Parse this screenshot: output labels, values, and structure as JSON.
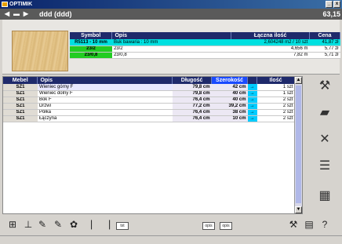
{
  "window": {
    "app_title": "OPTIMIK"
  },
  "header": {
    "title": "ddd (ddd)",
    "price": "63,15"
  },
  "price_table": {
    "columns": [
      "Symbol",
      "Opis",
      "Łączna ilość",
      "Cena"
    ],
    "rows": [
      {
        "symbol": "R5113 - 10 mm",
        "opis": "Buk bawaria : 10 mm",
        "ilosc": "2,604248 m2 / 10 szt",
        "cena": "41,87 zł"
      },
      {
        "symbol": "23/2",
        "opis": "23/2",
        "ilosc": "4,656 m",
        "cena": "5,77 zł"
      },
      {
        "symbol": "23/0,8",
        "opis": "23/0,8",
        "ilosc": "7,82 m",
        "cena": "5,71 zł"
      }
    ]
  },
  "elements_table": {
    "columns": [
      "Mebel",
      "Opis",
      "Długość",
      "Szerokość",
      "",
      "Ilość"
    ],
    "rows": [
      {
        "mebel": "SZ1",
        "opis": "Wieniec górny F",
        "dlugosc": "79,8 cm",
        "szerokosc": "42 cm",
        "arrow": "→",
        "ilosc": "1 szt"
      },
      {
        "mebel": "SZ1",
        "opis": "Wieniec dolny F",
        "dlugosc": "79,8 cm",
        "szerokosc": "40 cm",
        "arrow": "→",
        "ilosc": "1 szt"
      },
      {
        "mebel": "SZ1",
        "opis": "Bok F",
        "dlugosc": "76,4 cm",
        "szerokosc": "40 cm",
        "arrow": "→",
        "ilosc": "2 szt"
      },
      {
        "mebel": "SZ1",
        "opis": "Drzwi",
        "dlugosc": "77,2 cm",
        "szerokosc": "39,2 cm",
        "arrow": "→",
        "ilosc": "2 szt"
      },
      {
        "mebel": "SZ1",
        "opis": "Półka",
        "dlugosc": "76,4 cm",
        "szerokosc": "38 cm",
        "arrow": "→",
        "ilosc": "2 szt"
      },
      {
        "mebel": "SZ1",
        "opis": "Łączyna",
        "dlugosc": "76,4 cm",
        "szerokosc": "10 cm",
        "arrow": "→",
        "ilosc": "2 szt"
      }
    ]
  },
  "toolbar": {
    "txt_label": "txt",
    "opis_label": "opis"
  },
  "colors": {
    "title_bar": "#0a246a",
    "header_bg": "#5a5a5a",
    "table_header": "#1f2a6b",
    "highlight_cyan": "#00e0e0",
    "highlight_green": "#22cc22",
    "szerokosc_arrow": "#00ccff"
  },
  "icons": {
    "side": [
      "saw-icon",
      "panels-icon",
      "cross-icon",
      "layers-icon",
      "cabinet-icon"
    ],
    "bottom": [
      "add-element-icon",
      "drill-icon",
      "edge-band-icon",
      "edge-band-alt-icon",
      "tools-icon",
      "hinge-icon",
      "export-txt-icon",
      "import-opis-icon",
      "export-opis-icon",
      "wrench-icon",
      "print-icon",
      "help-icon"
    ]
  }
}
